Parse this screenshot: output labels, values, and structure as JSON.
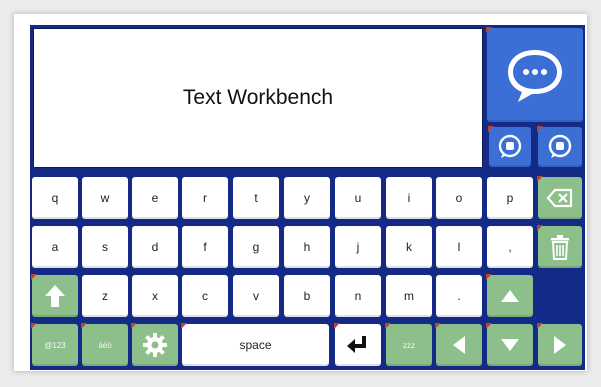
{
  "app": {
    "display_text": "Text Workbench"
  },
  "keyboard": {
    "row1": [
      "q",
      "w",
      "e",
      "r",
      "t",
      "y",
      "u",
      "i",
      "o",
      "p"
    ],
    "row2": [
      "a",
      "s",
      "d",
      "f",
      "g",
      "h",
      "j",
      "k",
      "l",
      ","
    ],
    "row3": [
      "z",
      "x",
      "c",
      "v",
      "b",
      "n",
      "m",
      "."
    ],
    "space_label": "space",
    "symbols_label": "@123",
    "accents_label": "àéö",
    "sleep_label": "zzz"
  },
  "icons": {
    "speak": "speech-bubble-icon",
    "quick1": "chat-bubble-icon",
    "quick2": "chat-bubble-icon",
    "backspace": "backspace-icon",
    "clear": "trash-icon",
    "shift": "shift-arrow-icon",
    "settings": "gear-icon",
    "enter": "enter-icon",
    "left": "left-arrow-icon",
    "down": "down-arrow-icon",
    "right": "right-arrow-icon",
    "up": "up-arrow-icon"
  },
  "colors": {
    "board": "#132a86",
    "action_key": "#8dbf8a",
    "speak_key": "#3b6fd6",
    "corner_marker": "#c0442a"
  }
}
